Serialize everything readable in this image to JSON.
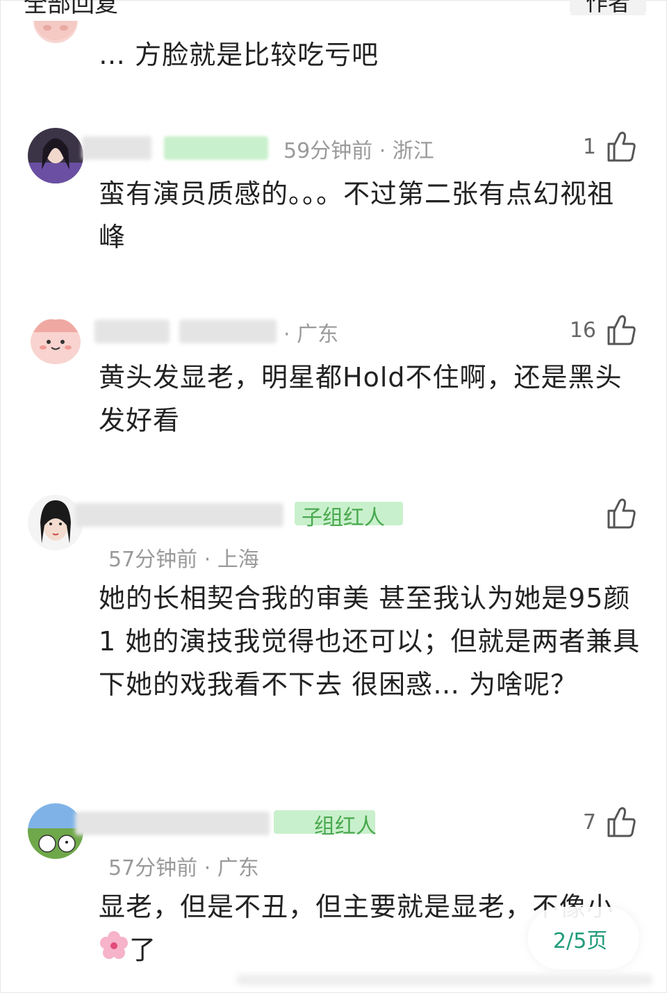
{
  "header": {
    "title": "全部回复",
    "author_button": "作者"
  },
  "comments": [
    {
      "text": "… 方脸就是比较吃亏吧"
    },
    {
      "badge": "",
      "time": "59分钟前",
      "location": "浙江",
      "likes": "1",
      "text": "蛮有演员质感的。。。不过第二张有点幻视祖峰"
    },
    {
      "time": "",
      "location": "广东",
      "likes": "16",
      "text": "黄头发显老，明星都Hold不住啊，还是黑头发好看"
    },
    {
      "badge": "子组红人",
      "time": "57分钟前",
      "location": "上海",
      "likes": "",
      "text": "她的长相契合我的审美 甚至我认为她是95颜1 她的演技我觉得也还可以；但就是两者兼具下她的戏我看不下去 很困惑… 为啥呢？"
    },
    {
      "badge": "组红人",
      "time": "57分钟前",
      "location": "广东",
      "likes": "7",
      "text_before": "显老，但是不丑，但主要就是显老，不像小",
      "text_after": "了"
    }
  ],
  "pager": {
    "label": "2/5页"
  },
  "icons": {
    "like": "thumbs-up-icon",
    "flower": "cherry-blossom-icon"
  },
  "colors": {
    "accent": "#1f9b7a",
    "badge_bg": "#c9f0cc",
    "badge_text": "#4aa84f",
    "meta_text": "#9a9a9a"
  }
}
